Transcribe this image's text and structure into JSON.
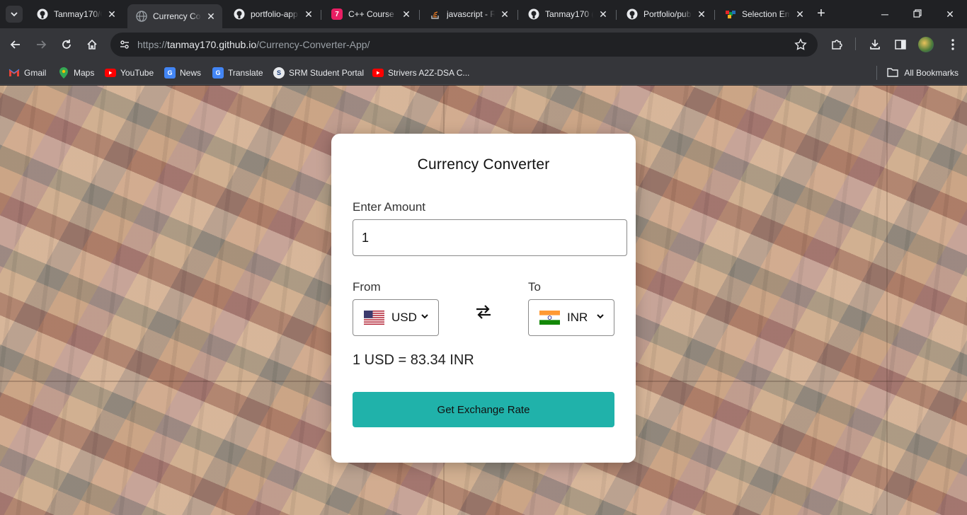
{
  "browser": {
    "tabs": [
      {
        "title": "Tanmay170/C",
        "favicon": "github-icon",
        "active": false
      },
      {
        "title": "Currency Con",
        "favicon": "globe-icon",
        "active": true
      },
      {
        "title": "portfolio-app",
        "favicon": "github-icon",
        "active": false
      },
      {
        "title": "C++ Course",
        "favicon": "course-icon",
        "active": false
      },
      {
        "title": "javascript - R",
        "favicon": "stackoverflow-icon",
        "active": false
      },
      {
        "title": "Tanmay170 (",
        "favicon": "github-icon",
        "active": false
      },
      {
        "title": "Portfolio/pub",
        "favicon": "github-icon",
        "active": false
      },
      {
        "title": "Selection Em",
        "favicon": "zoho-icon",
        "active": false
      }
    ],
    "url": {
      "scheme": "https://",
      "host": "tanmay170.github.io",
      "path": "/Currency-Converter-App/"
    },
    "bookmarks": [
      {
        "label": "Gmail",
        "icon": "gmail-icon",
        "color": "#ea4335"
      },
      {
        "label": "Maps",
        "icon": "maps-icon",
        "color": "#34a853"
      },
      {
        "label": "YouTube",
        "icon": "youtube-icon",
        "color": "#ff0000"
      },
      {
        "label": "News",
        "icon": "news-icon",
        "color": "#4285f4"
      },
      {
        "label": "Translate",
        "icon": "translate-icon",
        "color": "#4285f4"
      },
      {
        "label": "SRM Student Portal",
        "icon": "srm-icon",
        "color": "#1a3d7c"
      },
      {
        "label": "Strivers A2Z-DSA C...",
        "icon": "youtube-icon",
        "color": "#ff0000"
      }
    ],
    "all_bookmarks_label": "All Bookmarks"
  },
  "app": {
    "title": "Currency Converter",
    "amount_label": "Enter Amount",
    "amount_value": "1",
    "from_label": "From",
    "to_label": "To",
    "from_currency": "USD",
    "to_currency": "INR",
    "result_text": "1 USD = 83.34 INR",
    "button_label": "Get Exchange Rate",
    "button_color": "#20b2aa"
  }
}
